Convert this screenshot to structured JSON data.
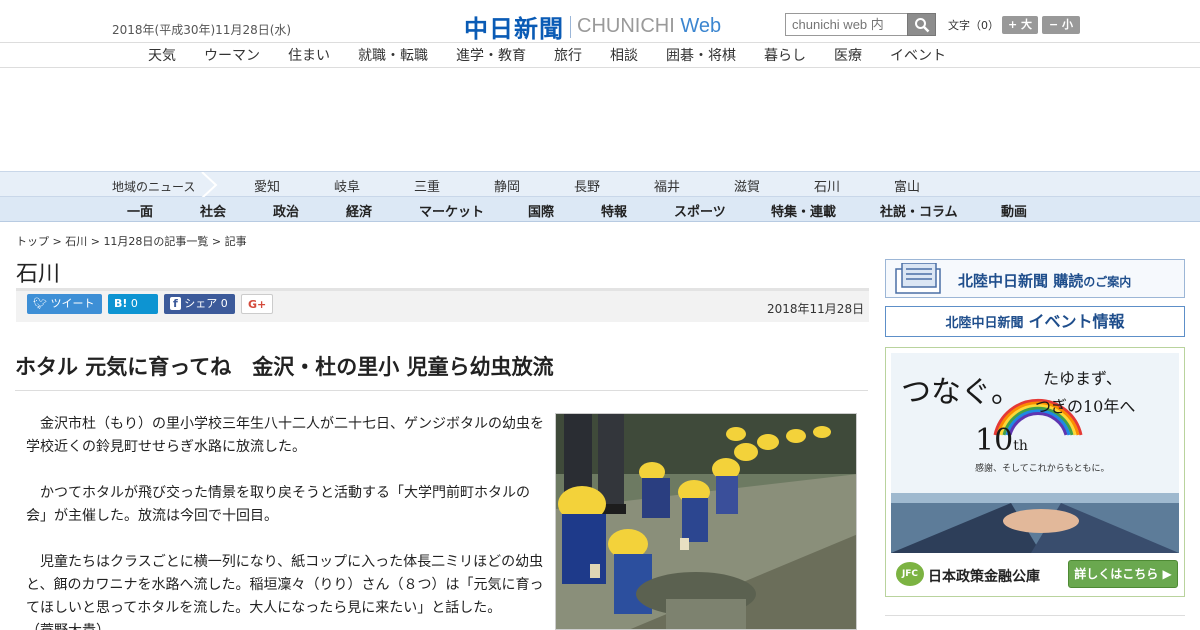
{
  "header": {
    "date": "2018年(平成30年)11月28日(水)",
    "logo_ja": "中日新聞",
    "logo_en_prefix": "CHUNICHI",
    "logo_en_suffix": "Web",
    "search_placeholder": "chunichi web 内",
    "font_size_label": "文字（0）",
    "font_plus": "+ 大",
    "font_minus": "− 小"
  },
  "nav1": [
    "天気",
    "ウーマン",
    "住まい",
    "就職・転職",
    "進学・教育",
    "旅行",
    "相談",
    "囲碁・将棋",
    "暮らし",
    "医療",
    "イベント"
  ],
  "region": {
    "label": "地域のニュース",
    "items": [
      "愛知",
      "岐阜",
      "三重",
      "静岡",
      "長野",
      "福井",
      "滋賀",
      "石川",
      "富山"
    ]
  },
  "categories": [
    "一面",
    "社会",
    "政治",
    "経済",
    "マーケット",
    "国際",
    "特報",
    "スポーツ",
    "特集・連載",
    "社説・コラム",
    "動画"
  ],
  "breadcrumb": {
    "top": "トップ",
    "sep": " > ",
    "region": "石川",
    "list": "11月28日の記事一覧",
    "current": "記事"
  },
  "section_title": "石川",
  "share": {
    "tweet": "ツイート",
    "hatena_count": "0",
    "facebook": "シェア",
    "facebook_count": "0",
    "gplus": "G+"
  },
  "article": {
    "date": "2018年11月28日",
    "headline": "ホタル 元気に育ってね　金沢・杜の里小 児童ら幼虫放流",
    "paragraphs": [
      "金沢市杜（もり）の里小学校三年生八十二人が二十七日、ゲンジボタルの幼虫を学校近くの鈴見町せせらぎ水路に放流した。",
      "かつてホタルが飛び交った情景を取り戻そうと活動する「大学門前町ホタルの会」が主催した。放流は今回で十回目。",
      "児童たちはクラスごとに横一列になり、紙コップに入った体長二ミリほどの幼虫と、餌のカワニナを水路へ流した。稲垣凜々（りり）さん（８つ）は「元気に育ってほしいと思ってホタルを流した。大人になったら見に来たい」と話した。",
      "（蓑野大貴）"
    ]
  },
  "sidebar": {
    "banner1_title": "北陸中日新聞",
    "banner1_strong": "購読",
    "banner1_suffix": "のご案内",
    "banner2_title": "北陸中日新聞",
    "banner2_strong": "イベント情報",
    "ad": {
      "headline": "つなぐ。",
      "subline1": "たゆまず、",
      "subline2": "つぎの10年へ",
      "tenth": "10",
      "tenth_suffix": "th",
      "tagline": "感謝、そしてこれからもともに。",
      "org_logo": "JFC",
      "org_name": "日本政策金融公庫",
      "cta": "詳しくはこちら ▶"
    }
  }
}
